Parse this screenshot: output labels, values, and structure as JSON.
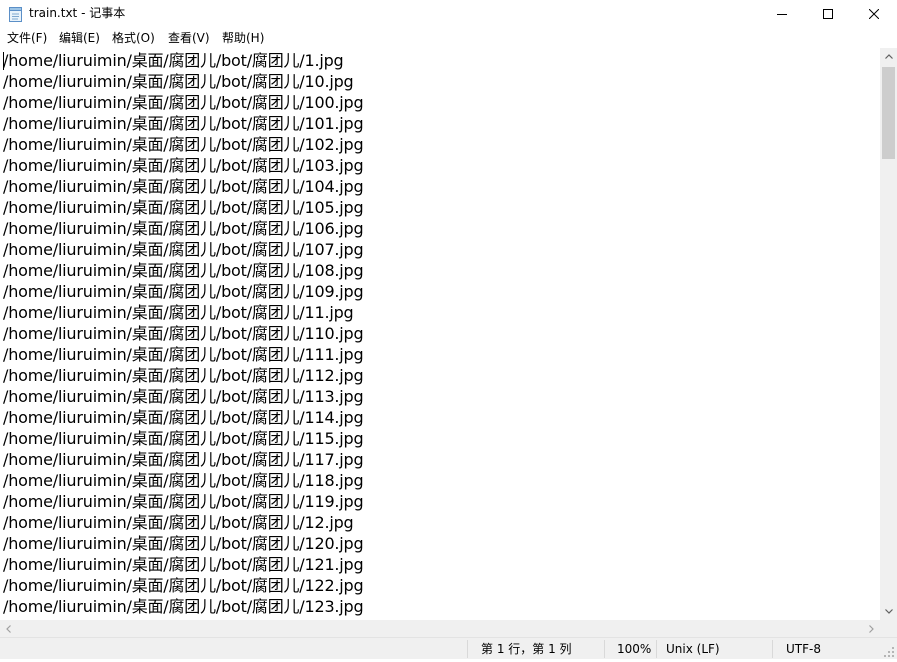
{
  "window": {
    "title": "train.txt - 记事本"
  },
  "title_icons": {
    "app": "notepad-icon",
    "minimize": "minimize-icon",
    "maximize": "maximize-icon",
    "close": "close-icon"
  },
  "menu": {
    "file": "文件(F)",
    "edit": "编辑(E)",
    "format": "格式(O)",
    "view": "查看(V)",
    "help": "帮助(H)"
  },
  "editor": {
    "lines": [
      "/home/liuruimin/桌面/腐团儿/bot/腐团儿/1.jpg",
      "/home/liuruimin/桌面/腐团儿/bot/腐团儿/10.jpg",
      "/home/liuruimin/桌面/腐团儿/bot/腐团儿/100.jpg",
      "/home/liuruimin/桌面/腐团儿/bot/腐团儿/101.jpg",
      "/home/liuruimin/桌面/腐团儿/bot/腐团儿/102.jpg",
      "/home/liuruimin/桌面/腐团儿/bot/腐团儿/103.jpg",
      "/home/liuruimin/桌面/腐团儿/bot/腐团儿/104.jpg",
      "/home/liuruimin/桌面/腐团儿/bot/腐团儿/105.jpg",
      "/home/liuruimin/桌面/腐团儿/bot/腐团儿/106.jpg",
      "/home/liuruimin/桌面/腐团儿/bot/腐团儿/107.jpg",
      "/home/liuruimin/桌面/腐团儿/bot/腐团儿/108.jpg",
      "/home/liuruimin/桌面/腐团儿/bot/腐团儿/109.jpg",
      "/home/liuruimin/桌面/腐团儿/bot/腐团儿/11.jpg",
      "/home/liuruimin/桌面/腐团儿/bot/腐团儿/110.jpg",
      "/home/liuruimin/桌面/腐团儿/bot/腐团儿/111.jpg",
      "/home/liuruimin/桌面/腐团儿/bot/腐团儿/112.jpg",
      "/home/liuruimin/桌面/腐团儿/bot/腐团儿/113.jpg",
      "/home/liuruimin/桌面/腐团儿/bot/腐团儿/114.jpg",
      "/home/liuruimin/桌面/腐团儿/bot/腐团儿/115.jpg",
      "/home/liuruimin/桌面/腐团儿/bot/腐团儿/117.jpg",
      "/home/liuruimin/桌面/腐团儿/bot/腐团儿/118.jpg",
      "/home/liuruimin/桌面/腐团儿/bot/腐团儿/119.jpg",
      "/home/liuruimin/桌面/腐团儿/bot/腐团儿/12.jpg",
      "/home/liuruimin/桌面/腐团儿/bot/腐团儿/120.jpg",
      "/home/liuruimin/桌面/腐团儿/bot/腐团儿/121.jpg",
      "/home/liuruimin/桌面/腐团儿/bot/腐团儿/122.jpg",
      "/home/liuruimin/桌面/腐团儿/bot/腐团儿/123.jpg"
    ]
  },
  "scrollbar_icons": {
    "up": "chevron-up-icon",
    "down": "chevron-down-icon",
    "left": "chevron-left-icon",
    "right": "chevron-right-icon"
  },
  "status": {
    "position": "第 1 行，第 1 列",
    "zoom": "100%",
    "line_ending": "Unix (LF)",
    "encoding": "UTF-8"
  },
  "colors": {
    "background": "#ffffff",
    "chrome": "#f0f0f0",
    "scroll_thumb": "#cdcdcd",
    "text": "#000000"
  }
}
